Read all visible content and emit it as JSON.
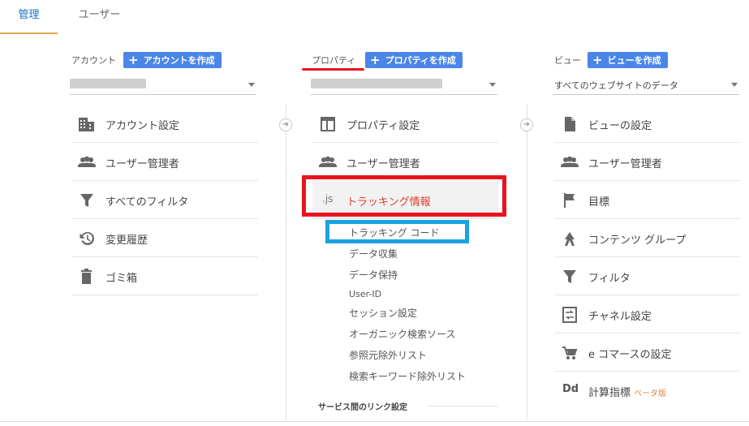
{
  "tabs": [
    {
      "label": "管理",
      "active": true
    },
    {
      "label": "ユーザー",
      "active": false
    }
  ],
  "columns": {
    "account": {
      "label": "アカウント",
      "create_button": "アカウントを作成",
      "selector_value": "",
      "items": [
        {
          "label": "アカウント設定",
          "icon": "building-icon"
        },
        {
          "label": "ユーザー管理者",
          "icon": "people-icon"
        },
        {
          "label": "すべてのフィルタ",
          "icon": "funnel-icon"
        },
        {
          "label": "変更履歴",
          "icon": "history-icon"
        },
        {
          "label": "ゴミ箱",
          "icon": "trash-icon"
        }
      ]
    },
    "property": {
      "label": "プロパティ",
      "create_button": "プロパティを作成",
      "selector_value": "",
      "items": [
        {
          "label": "プロパティ設定",
          "icon": "window-icon"
        },
        {
          "label": "ユーザー管理者",
          "icon": "people-icon"
        },
        {
          "label": "トラッキング情報",
          "icon": "js-icon",
          "icon_text": ".js",
          "selected": true
        }
      ],
      "sub_items": [
        "トラッキング コード",
        "データ収集",
        "データ保持",
        "User-ID",
        "セッション設定",
        "オーガニック検索ソース",
        "参照元除外リスト",
        "検索キーワード除外リスト"
      ],
      "section_heading": "サービス間のリンク設定"
    },
    "view": {
      "label": "ビュー",
      "create_button": "ビューを作成",
      "selector_value": "すべてのウェブサイトのデータ",
      "items": [
        {
          "label": "ビューの設定",
          "icon": "document-icon"
        },
        {
          "label": "ユーザー管理者",
          "icon": "people-icon"
        },
        {
          "label": "目標",
          "icon": "flag-icon"
        },
        {
          "label": "コンテンツ グループ",
          "icon": "content-group-icon"
        },
        {
          "label": "フィルタ",
          "icon": "funnel-icon"
        },
        {
          "label": "チャネル設定",
          "icon": "channel-icon"
        },
        {
          "label": "e コマースの設定",
          "icon": "cart-icon"
        },
        {
          "label": "計算指標",
          "icon": "dd-icon",
          "icon_text": "Dd",
          "badge": "ベータ版"
        }
      ]
    }
  },
  "colors": {
    "accent_blue": "#4a86e8",
    "tab_underline": "#e8a94e",
    "selected_text": "#e23a2c",
    "annotation_red": "#e8141e",
    "annotation_blue": "#1aa3e0"
  }
}
